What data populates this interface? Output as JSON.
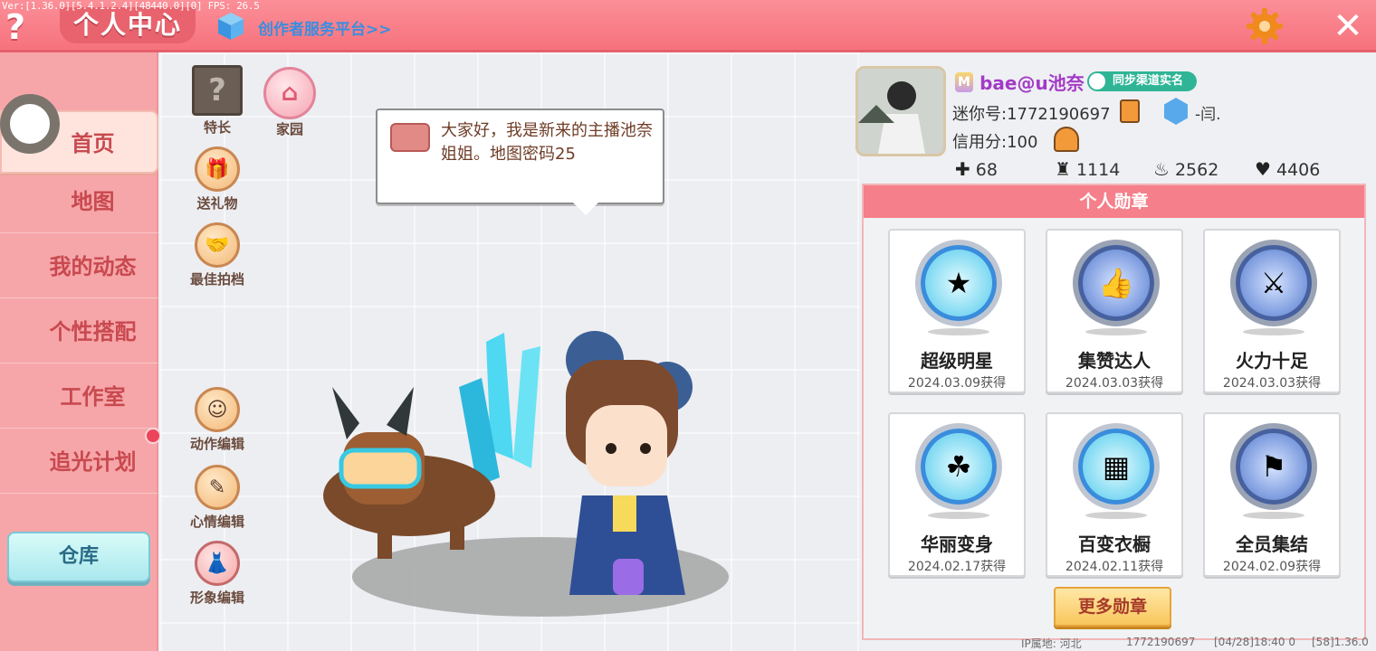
{
  "debug": "Ver:[1.36.0][5.4.1.2.4][48440.0][0] FPS: 26.5",
  "header": {
    "help_glyph": "?",
    "title": "个人中心",
    "creator_link": "创作者服务平台>>",
    "close_glyph": "✕"
  },
  "sidebar": {
    "items": [
      {
        "label": "首页",
        "active": true
      },
      {
        "label": "地图"
      },
      {
        "label": "我的动态"
      },
      {
        "label": "个性搭配"
      },
      {
        "label": "工作室"
      },
      {
        "label": "追光计划"
      }
    ],
    "warehouse": "仓库"
  },
  "stage": {
    "buttons": {
      "specialty": "特长",
      "home": "家园",
      "send_gift": "送礼物",
      "best_partner": "最佳拍档",
      "action_edit": "动作编辑",
      "mood_edit": "心情编辑",
      "image_edit": "形象编辑"
    },
    "speech": "大家好，我是新来的主播池奈姐姐。地图密码25"
  },
  "profile": {
    "vip_glyph": "M",
    "username": "bae@u池奈",
    "verify_badge": "同步渠道实名",
    "mini_id": "迷你号:1772190697",
    "team": "-闫.",
    "credit": "信用分:100",
    "stats": {
      "friends": "68",
      "fans": "1114",
      "popularity": "2562",
      "likes": "4406"
    }
  },
  "badges": {
    "header": "个人勋章",
    "items": [
      {
        "name": "超级明星",
        "date": "2024.03.09获得",
        "style": "teal"
      },
      {
        "name": "集赞达人",
        "date": "2024.03.03获得",
        "style": "blue"
      },
      {
        "name": "火力十足",
        "date": "2024.03.03获得",
        "style": "blue"
      },
      {
        "name": "华丽变身",
        "date": "2024.02.17获得",
        "style": "teal"
      },
      {
        "name": "百变衣橱",
        "date": "2024.02.11获得",
        "style": "teal"
      },
      {
        "name": "全员集结",
        "date": "2024.02.09获得",
        "style": "blue"
      }
    ],
    "more": "更多勋章"
  },
  "footer": {
    "ip": "IP属地: 河北",
    "uid": "1772190697",
    "time": "[04/28]18:40 0",
    "version": "[58]1.36.0"
  },
  "colors": {
    "topbar": "#f6727d",
    "sidebar": "#f6a6a9",
    "accent_text": "#c8494f",
    "badge_header": "#f57f8a"
  }
}
